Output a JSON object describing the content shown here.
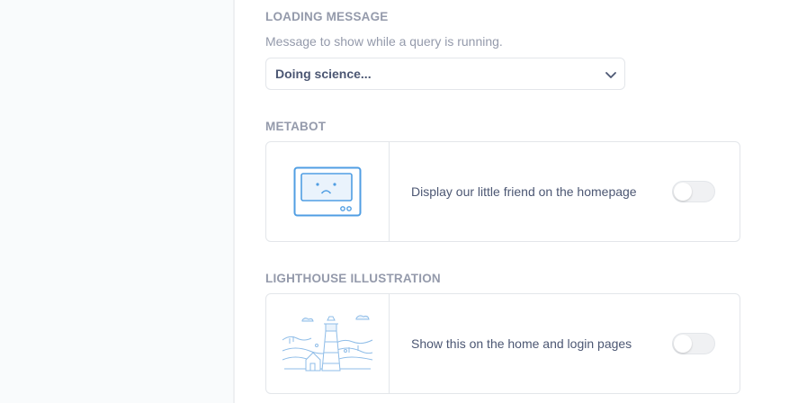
{
  "loading": {
    "title": "LOADING MESSAGE",
    "description": "Message to show while a query is running.",
    "selected": "Doing science..."
  },
  "metabot": {
    "title": "METABOT",
    "text": "Display our little friend on the homepage",
    "enabled": false
  },
  "lighthouse": {
    "title": "LIGHTHOUSE ILLUSTRATION",
    "text": "Show this on the home and login pages",
    "enabled": false
  },
  "icons": {
    "select_chevron": "chevron-down-icon",
    "metabot": "metabot-illustration",
    "lighthouse": "lighthouse-illustration"
  },
  "colors": {
    "brand": "#509ee3",
    "label": "#949aab",
    "text": "#4c5773",
    "border": "#e3e6ea"
  }
}
